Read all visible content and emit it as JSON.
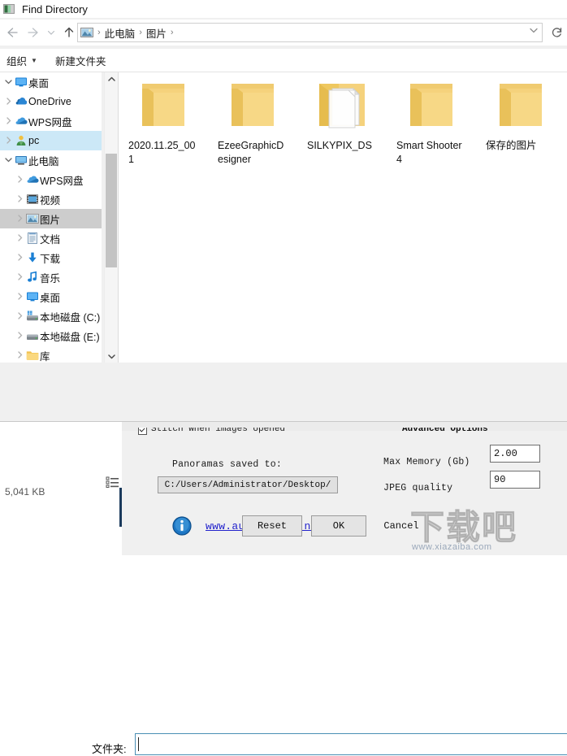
{
  "dialog": {
    "title": "Find Directory",
    "title_icon": "window-icon",
    "nav": {
      "back_icon": "arrow-left-icon",
      "forward_icon": "arrow-right-icon",
      "recent_icon": "chevron-down-icon",
      "up_icon": "arrow-up-icon",
      "refresh_icon": "refresh-icon",
      "address_icon": "pictures-icon",
      "address_dropdown_icon": "chevron-down-icon",
      "breadcrumbs": [
        "此电脑",
        "图片"
      ],
      "separator": "›"
    },
    "commandbar": {
      "organize": "组织",
      "organize_caret": "▼",
      "new_folder": "新建文件夹"
    },
    "nav_pane": {
      "scroll_up_icon": "chevron-up-icon",
      "scroll_down_icon": "chevron-down-icon",
      "items": [
        {
          "label": "桌面",
          "icon": "monitor-icon",
          "indent": 1,
          "chevron": "v",
          "state": "none"
        },
        {
          "label": "OneDrive",
          "icon": "cloud-icon",
          "indent": 2,
          "chevron": ">",
          "state": "none"
        },
        {
          "label": "WPS网盘",
          "icon": "cloud-blue-icon",
          "indent": 2,
          "chevron": ">",
          "state": "none"
        },
        {
          "label": "pc",
          "icon": "user-icon",
          "indent": 2,
          "chevron": ">",
          "state": "selected-blue"
        },
        {
          "label": "此电脑",
          "icon": "computer-icon",
          "indent": 2,
          "chevron": "v",
          "state": "none"
        },
        {
          "label": "WPS网盘",
          "icon": "cloud-blue-icon",
          "indent": 3,
          "chevron": ">",
          "state": "none"
        },
        {
          "label": "视频",
          "icon": "video-icon",
          "indent": 3,
          "chevron": ">",
          "state": "none"
        },
        {
          "label": "图片",
          "icon": "pictures-icon",
          "indent": 3,
          "chevron": ">",
          "state": "selected-gray"
        },
        {
          "label": "文档",
          "icon": "documents-icon",
          "indent": 3,
          "chevron": ">",
          "state": "none"
        },
        {
          "label": "下载",
          "icon": "download-icon",
          "indent": 3,
          "chevron": ">",
          "state": "none"
        },
        {
          "label": "音乐",
          "icon": "music-icon",
          "indent": 3,
          "chevron": ">",
          "state": "none"
        },
        {
          "label": "桌面",
          "icon": "monitor-icon",
          "indent": 3,
          "chevron": ">",
          "state": "none"
        },
        {
          "label": "本地磁盘 (C:)",
          "icon": "disk-system-icon",
          "indent": 3,
          "chevron": ">",
          "state": "none"
        },
        {
          "label": "本地磁盘 (E:)",
          "icon": "disk-icon",
          "indent": 3,
          "chevron": ">",
          "state": "none"
        },
        {
          "label": "库",
          "icon": "folder-icon",
          "indent": 3,
          "chevron": ">",
          "state": "none"
        }
      ]
    },
    "files": [
      {
        "name": "2020.11.25_001",
        "icon": "folder-icon"
      },
      {
        "name": "EzeeGraphicDesigner",
        "icon": "folder-icon"
      },
      {
        "name": "SILKYPIX_DS",
        "icon": "folder-with-file-icon"
      },
      {
        "name": "Smart Shooter 4",
        "icon": "folder-icon"
      },
      {
        "name": "保存的图片",
        "icon": "folder-icon"
      }
    ],
    "folder_field": {
      "label": "文件夹:",
      "value": "",
      "placeholder": ""
    }
  },
  "background": {
    "status_size": "5,041 KB",
    "view_modes": [
      {
        "name": "details-view-icon",
        "active": false
      },
      {
        "name": "thumbnail-view-icon",
        "active": true
      }
    ]
  },
  "stitch_panel": {
    "stitch_checkbox_label": "Stitch when images opened",
    "stitch_checkbox_checked": true,
    "advanced_options_label": "Advanced Options",
    "panoramas_label": "Panoramas saved to:",
    "panoramas_path": "C:/Users/Administrator/Desktop/",
    "max_memory_label": "Max Memory (Gb)",
    "max_memory_value": "2.00",
    "jpeg_quality_label": "JPEG quality",
    "jpeg_quality_value": "90",
    "info_icon": "info-icon",
    "link_text": "www.autostitch.net",
    "buttons": {
      "reset": "Reset",
      "ok": "OK",
      "cancel": "Cancel"
    }
  },
  "watermark": {
    "text": "下载吧",
    "url": "www.xiazaiba.com"
  },
  "colors": {
    "accent_selection": "#cce8f7",
    "accent_selection_gray": "#cdcdcd",
    "folder_yellow": "#f5d27c",
    "link_blue": "#2222cc",
    "window_chrome": "#1b3a5c",
    "panel_bg": "#f0f0f0",
    "input_border": "#4a8fb5"
  }
}
